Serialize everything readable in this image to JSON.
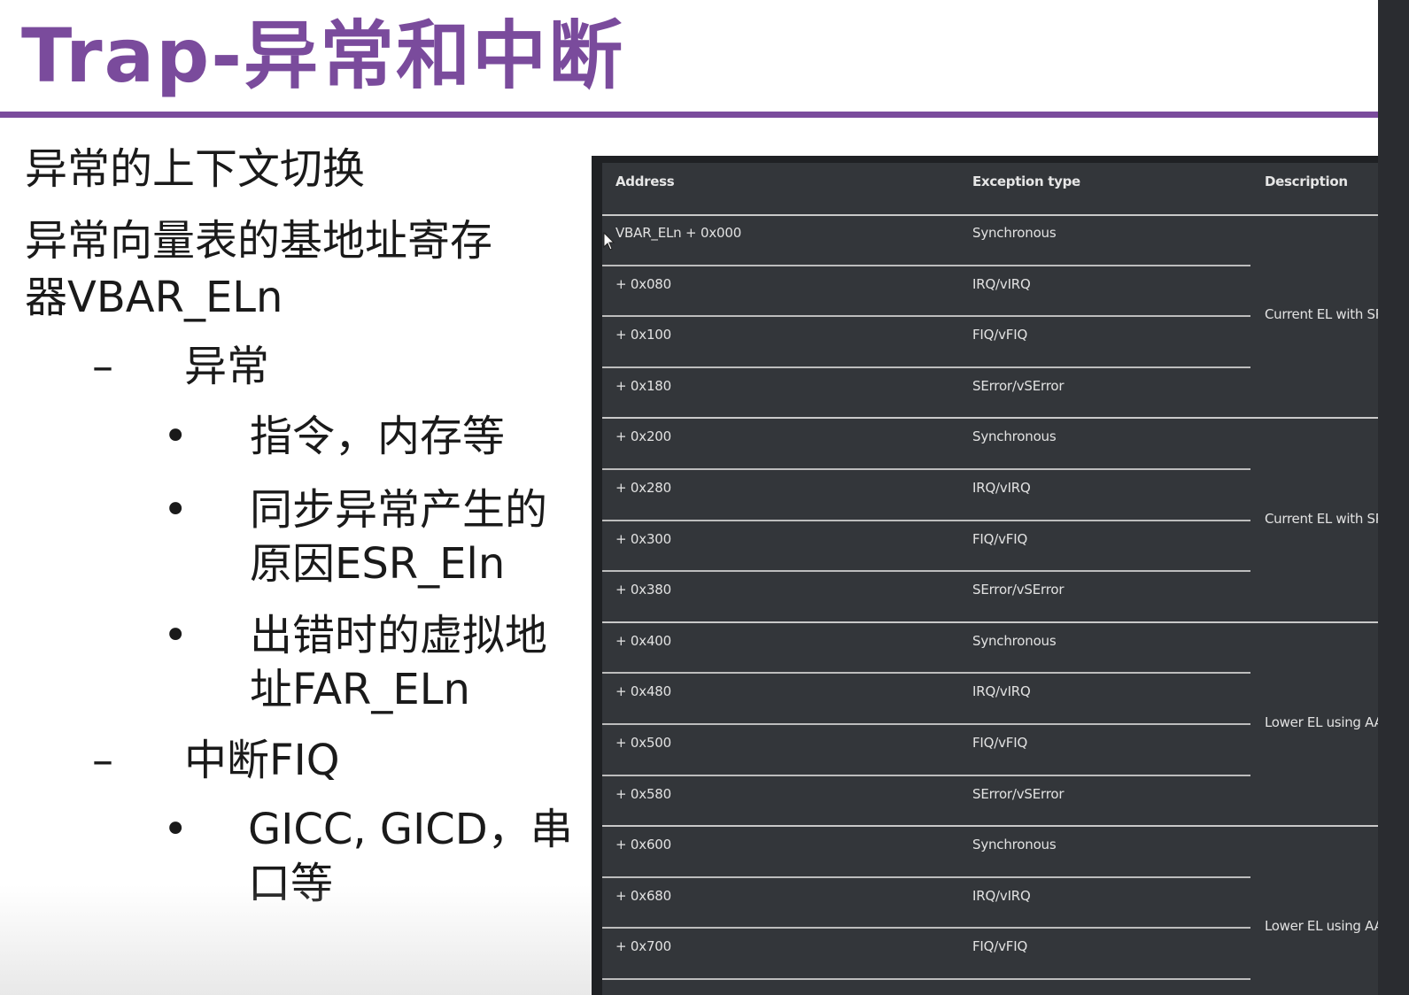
{
  "slide": {
    "title": "Trap-异常和中断",
    "accent_color": "#7a4b9c"
  },
  "bullets": [
    {
      "level": 1,
      "marker": "",
      "lines": [
        "异常的上下文切换"
      ]
    },
    {
      "level": 1,
      "marker": "",
      "lines": [
        "异常向量表的基地址寄存",
        "器VBAR_ELn"
      ]
    },
    {
      "level": 2,
      "marker": "–",
      "lines": [
        "异常"
      ]
    },
    {
      "level": 3,
      "marker": "•",
      "lines": [
        "指令，内存等"
      ]
    },
    {
      "level": 3,
      "marker": "•",
      "lines": [
        "同步异常产生的",
        "原因ESR_Eln"
      ]
    },
    {
      "level": 3,
      "marker": "•",
      "lines": [
        "出错时的虚拟地",
        "址FAR_ELn"
      ]
    },
    {
      "level": 2,
      "marker": "–",
      "lines": [
        "中断FIQ"
      ]
    },
    {
      "level": 3,
      "marker": "•",
      "lines": [
        "GICC, GICD，串",
        "口等"
      ]
    }
  ],
  "vector_table": {
    "headers": {
      "address": "Address",
      "exception_type": "Exception type",
      "description": "Description"
    },
    "rows": [
      {
        "address": "VBAR_ELn + 0x000",
        "type": "Synchronous"
      },
      {
        "address": "+ 0x080",
        "type": "IRQ/vIRQ"
      },
      {
        "address": "+ 0x100",
        "type": "FIQ/vFIQ"
      },
      {
        "address": "+ 0x180",
        "type": "SError/vSError"
      },
      {
        "address": "+ 0x200",
        "type": "Synchronous"
      },
      {
        "address": "+ 0x280",
        "type": "IRQ/vIRQ"
      },
      {
        "address": "+ 0x300",
        "type": "FIQ/vFIQ"
      },
      {
        "address": "+ 0x380",
        "type": "SError/vSError"
      },
      {
        "address": "+ 0x400",
        "type": "Synchronous"
      },
      {
        "address": "+ 0x480",
        "type": "IRQ/vIRQ"
      },
      {
        "address": "+ 0x500",
        "type": "FIQ/vFIQ"
      },
      {
        "address": "+ 0x580",
        "type": "SError/vSError"
      },
      {
        "address": "+ 0x600",
        "type": "Synchronous"
      },
      {
        "address": "+ 0x680",
        "type": "IRQ/vIRQ"
      },
      {
        "address": "+ 0x700",
        "type": "FIQ/vFIQ"
      }
    ],
    "groups": [
      {
        "description": "Current EL with SP"
      },
      {
        "description": "Current EL with SP"
      },
      {
        "description": "Lower EL using AA"
      },
      {
        "description": "Lower EL using AA"
      }
    ]
  },
  "icons": {
    "cursor": "mouse-pointer-icon"
  }
}
